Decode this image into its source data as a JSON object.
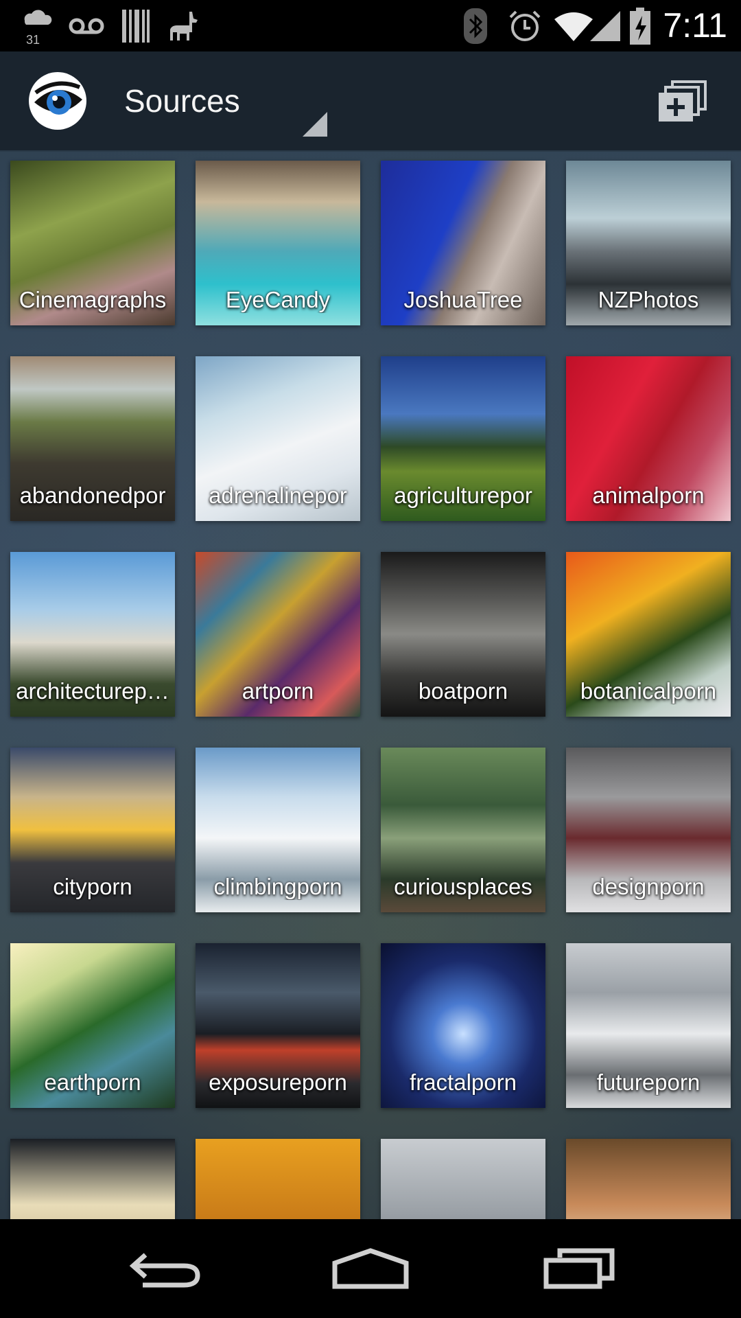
{
  "status_bar": {
    "time": "7:11",
    "calendar_day": "31",
    "icons": [
      "weather-calendar-icon",
      "voicemail-icon",
      "barcode-icon",
      "llama-icon",
      "bluetooth-icon",
      "alarm-icon",
      "wifi-icon",
      "signal-icon",
      "battery-charging-icon"
    ]
  },
  "action_bar": {
    "title": "Sources",
    "add_button_icon": "add-to-collection-icon"
  },
  "tiles": [
    {
      "label": "Cinemagraphs",
      "bg": "linear-gradient(160deg,#3b4a1e 0%,#8ea24c 35%,#6b7d35 55%,#b08a8a 75%,#4a3a2e 100%)"
    },
    {
      "label": "EyeCandy",
      "bg": "linear-gradient(180deg,#6a5a4a 0%,#c8b89a 25%,#4fa9b8 55%,#2ec0cc 75%,#8fe0e0 100%)"
    },
    {
      "label": "JoshuaTree",
      "bg": "linear-gradient(115deg,#1e2d9a 0%,#1e3fc6 40%,#8a7a70 55%,#c8bcb4 70%,#6e625a 100%)"
    },
    {
      "label": "NZPhotos",
      "bg": "linear-gradient(180deg,#6d8896 0%,#bccfd6 35%,#6a7278 55%,#2c3236 75%,#a0a8ac 100%)"
    },
    {
      "label": "abandonedpor",
      "bg": "linear-gradient(180deg,#a08a74 0%,#c0c8c4 20%,#6a7a46 40%,#3e3a30 65%,#2a2824 100%)"
    },
    {
      "label": "adrenalinepor",
      "bg": "linear-gradient(160deg,#7ea6c6 0%,#c8dde8 30%,#f2f4f6 55%,#dfe6ec 75%,#b8c4cc 100%)"
    },
    {
      "label": "agriculturepor",
      "bg": "linear-gradient(180deg,#1f3f8a 0%,#4a78c0 35%,#2e4a26 55%,#6a8a2e 70%,#2e5a1e 100%)"
    },
    {
      "label": "animalporn",
      "bg": "linear-gradient(120deg,#c01028 0%,#e0203a 35%,#b01a2a 55%,#c04860 75%,#f0c8d0 100%)"
    },
    {
      "label": "architecturep…",
      "bg": "linear-gradient(180deg,#5a9ad6 0%,#a8cce8 35%,#dcd8cc 55%,#3a4a2e 80%,#2a3a20 100%)"
    },
    {
      "label": "artporn",
      "bg": "linear-gradient(135deg,#c84a2a 0%,#3a7a9a 25%,#c8a030 45%,#5a2a6a 65%,#d85a5a 85%,#2a4a3a 100%)"
    },
    {
      "label": "boatporn",
      "bg": "linear-gradient(180deg,#1a1a1a 0%,#5a5a58 30%,#8a8a86 50%,#3a3a38 75%,#141414 100%)"
    },
    {
      "label": "botanicalporn",
      "bg": "linear-gradient(150deg,#e85a1a 0%,#f0b020 35%,#2a4a1a 60%,#c0d0c8 80%,#e8e8ec 100%)"
    },
    {
      "label": "cityporn",
      "bg": "linear-gradient(180deg,#3a4a6a 0%,#c8b48a 30%,#f0c040 50%,#3a3a3e 70%,#24262a 100%)"
    },
    {
      "label": "climbingporn",
      "bg": "linear-gradient(180deg,#6a9ac8 0%,#c8dcec 30%,#f4f6f8 55%,#8a9ca8 80%,#e8ecee 100%)"
    },
    {
      "label": "curiousplaces",
      "bg": "linear-gradient(180deg,#6a8a5a 0%,#3a5a3a 35%,#8aa07a 55%,#2a3a2a 80%,#5a4a3a 100%)"
    },
    {
      "label": "designporn",
      "bg": "linear-gradient(180deg,#5a5a5c 0%,#9a9a9c 30%,#6a2a2e 55%,#b8b8ba 80%,#e0e0e2 100%)"
    },
    {
      "label": "earthporn",
      "bg": "linear-gradient(150deg,#f8f0c0 0%,#c8d890 25%,#2a6a2a 50%,#4a8a9a 70%,#1e3a1e 100%)"
    },
    {
      "label": "exposureporn",
      "bg": "linear-gradient(180deg,#1a2230 0%,#4a5a6a 30%,#1a1e24 55%,#c0402a 65%,#2a2a2e 85%,#101214 100%)"
    },
    {
      "label": "fractalporn",
      "bg": "radial-gradient(circle at 50% 55%,#c8e0ff 0%,#4a7ad0 25%,#1a2a6a 60%,#0a1030 100%)"
    },
    {
      "label": "futureporn",
      "bg": "linear-gradient(180deg,#c8ccd0 0%,#9aa0a6 30%,#e8eaec 55%,#6a6e72 80%,#d8dadc 100%)"
    },
    {
      "label": "",
      "bg": "linear-gradient(180deg,#1a1e24 0%,#e8dcb8 40%,#c8b890 70%,#2a2e34 100%)"
    },
    {
      "label": "",
      "bg": "linear-gradient(180deg,#e8a020 0%,#c87a18 50%,#6a3a10 100%)"
    },
    {
      "label": "",
      "bg": "linear-gradient(180deg,#c8ccd0 0%,#9aa0a6 45%,#5a606a 100%)"
    },
    {
      "label": "",
      "bg": "linear-gradient(180deg,#6a4a2a 0%,#c88a5a 40%,#e8d0b0 70%,#a06a3a 100%)"
    }
  ],
  "nav_bar": {
    "icons": [
      "back-icon",
      "home-icon",
      "recent-apps-icon"
    ]
  }
}
